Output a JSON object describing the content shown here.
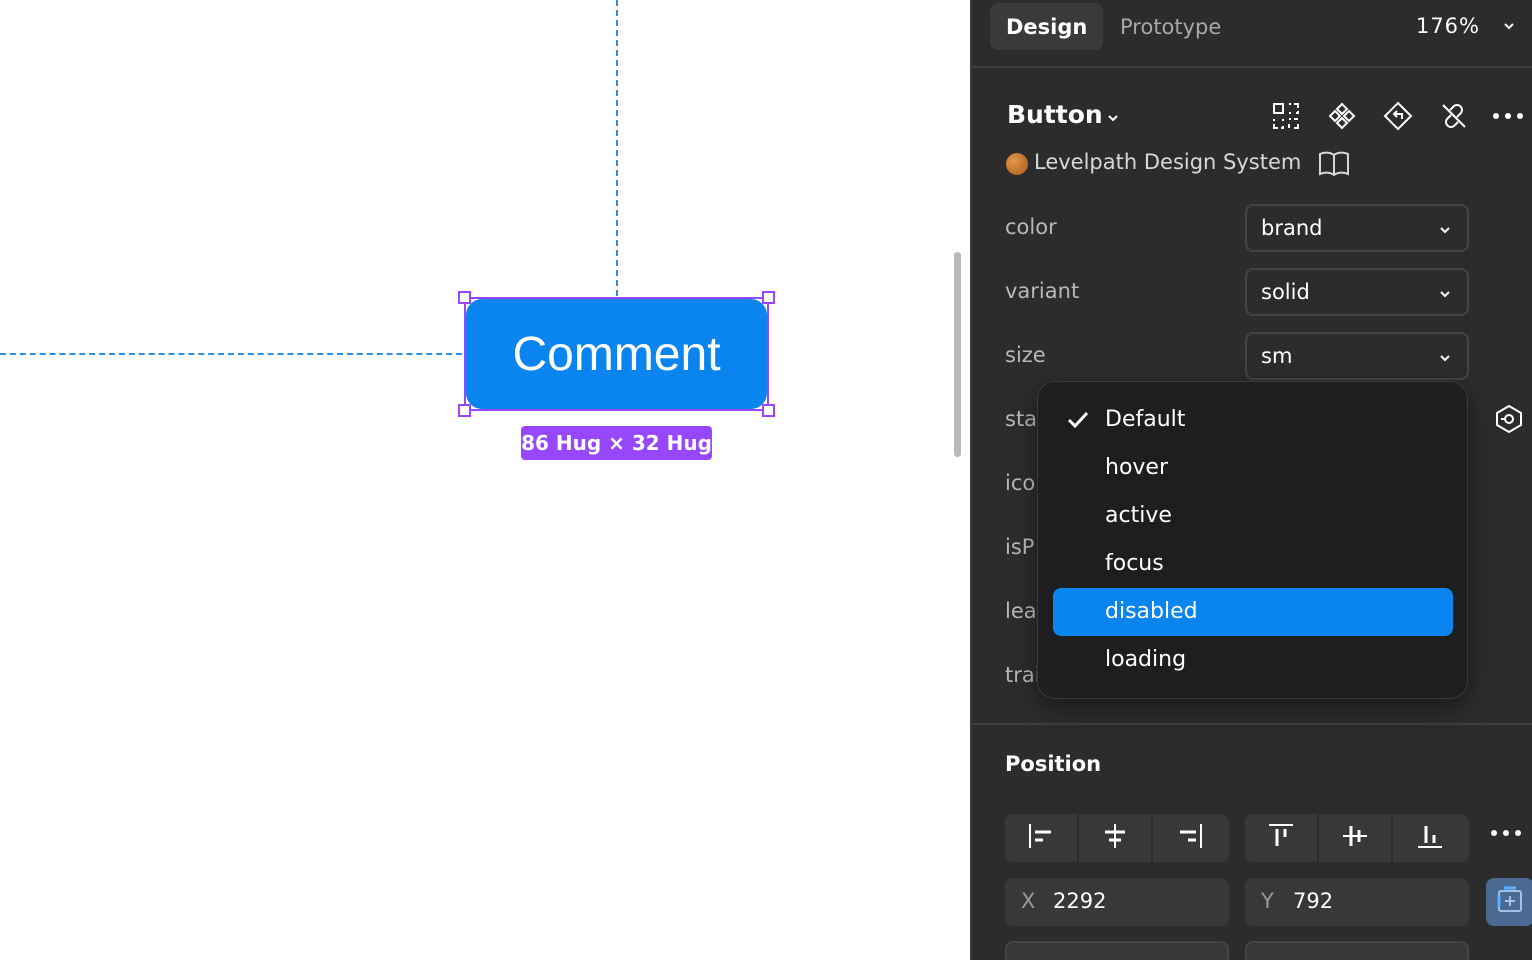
{
  "canvas": {
    "button_label": "Comment",
    "size_badge": "86 Hug × 32 Hug"
  },
  "tabs": {
    "design": "Design",
    "prototype": "Prototype",
    "zoom": "176%"
  },
  "component": {
    "title": "Button",
    "library": "Levelpath Design System"
  },
  "props": [
    {
      "label": "color",
      "value": "brand"
    },
    {
      "label": "variant",
      "value": "solid"
    },
    {
      "label": "size",
      "value": "sm"
    },
    {
      "label": "sta"
    },
    {
      "label": "ico"
    },
    {
      "label": "isP"
    },
    {
      "label": "lea"
    },
    {
      "label": "trai"
    }
  ],
  "state_dropdown": {
    "options": [
      "Default",
      "hover",
      "active",
      "focus",
      "disabled",
      "loading"
    ],
    "checked": "Default",
    "highlighted": "disabled"
  },
  "position": {
    "title": "Position",
    "x_label": "X",
    "x_value": "2292",
    "y_label": "Y",
    "y_value": "792"
  },
  "colors": {
    "accent": "#0a84ef",
    "selection": "#9747ff",
    "panel_bg": "#2c2c2c"
  },
  "icons": [
    "chevron-down-icon",
    "auto-layout-grid-icon",
    "component-icon",
    "go-to-main-icon",
    "detach-icon",
    "more-icon",
    "book-icon",
    "checkmark-icon",
    "instance-swap-icon",
    "align-left-icon",
    "align-center-icon",
    "align-right-icon",
    "align-top-icon",
    "align-middle-icon",
    "align-bottom-icon",
    "constraint-icon"
  ]
}
